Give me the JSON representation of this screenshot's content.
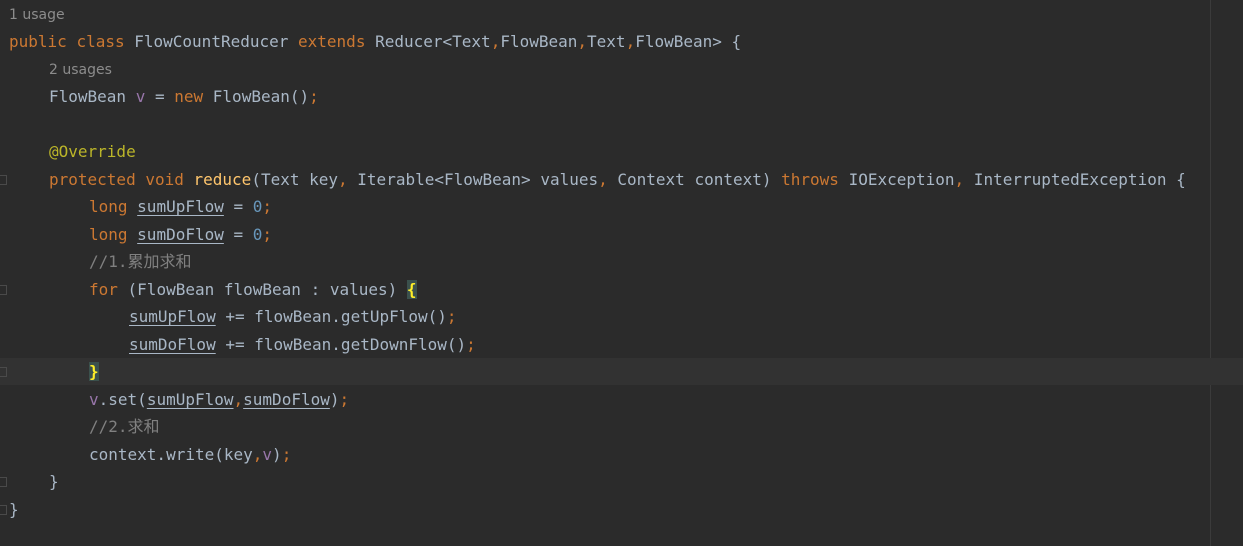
{
  "editor": {
    "usage_hint_class": "1 usage",
    "usage_hint_field": "2 usages",
    "class_decl": {
      "mod": "public",
      "kw_class": "class",
      "name": "FlowCountReducer",
      "kw_extends": "extends",
      "super": "Reducer<Text",
      "comma1": ",",
      "t2": "FlowBean",
      "comma2": ",",
      "t3": "Text",
      "comma3": ",",
      "t4": "FlowBean> {"
    },
    "field_decl": {
      "type": "FlowBean",
      "name": "v",
      "eq": " = ",
      "kw_new": "new",
      "ctor": " FlowBean()",
      "semi": ";"
    },
    "annotation": "@Override",
    "method_decl": {
      "kw_protected": "protected",
      "kw_void": "void",
      "name": "reduce",
      "params1": "(Text key",
      "c1": ",",
      "params2": " Iterable<FlowBean> values",
      "c2": ",",
      "params3": " Context context) ",
      "kw_throws": "throws",
      "ex1": " IOException",
      "c3": ",",
      "ex2": " InterruptedException {"
    },
    "var1": {
      "kw": "long",
      "name": "sumUpFlow",
      "eq": " = ",
      "num": "0",
      "semi": ";"
    },
    "var2": {
      "kw": "long",
      "name": "sumDoFlow",
      "eq": " = ",
      "num": "0",
      "semi": ";"
    },
    "comment1": "//1.累加求和",
    "for_stmt": {
      "kw_for": "for",
      "rest": " (FlowBean flowBean : values) ",
      "brace": "{"
    },
    "loop1": {
      "var": "sumUpFlow",
      "rest": " += flowBean.getUpFlow()",
      "semi": ";"
    },
    "loop2": {
      "var": "sumDoFlow",
      "rest": " += flowBean.getDownFlow()",
      "semi": ";"
    },
    "close_brace_hl": "}",
    "set_stmt": {
      "obj": "v",
      "call": ".set(",
      "a1": "sumUpFlow",
      "c": ",",
      "a2": "sumDoFlow",
      "close": ")",
      "semi": ";"
    },
    "comment2": "//2.求和",
    "write_stmt": {
      "call": "context.write(key",
      "c": ",",
      "arg": "v",
      "close": ")",
      "semi": ";"
    },
    "method_close": "}",
    "class_close": "}"
  }
}
